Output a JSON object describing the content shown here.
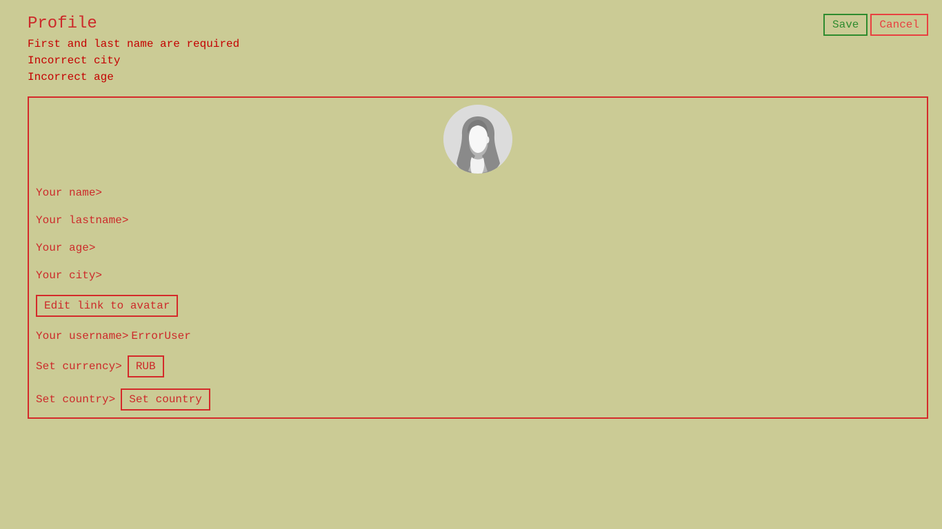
{
  "header": {
    "title": "Profile",
    "errors": [
      "First and last name are required",
      "Incorrect city",
      "Incorrect age"
    ],
    "save_label": "Save",
    "cancel_label": "Cancel"
  },
  "form": {
    "avatar_icon": "user-avatar-silhouette",
    "name_label": "Your name>",
    "lastname_label": "Your lastname>",
    "age_label": "Your age>",
    "city_label": "Your city>",
    "edit_avatar_label": "Edit link to avatar",
    "username_label": "Your username>",
    "username_value": "ErrorUser",
    "currency_label": "Set currency>",
    "currency_value": "RUB",
    "country_label": "Set country>",
    "country_value": "Set country"
  },
  "colors": {
    "background": "#cbcb95",
    "accent_red": "#cc2a2a",
    "error_red": "#c40000",
    "save_green": "#2e8b2e",
    "cancel_red": "#e84040"
  }
}
